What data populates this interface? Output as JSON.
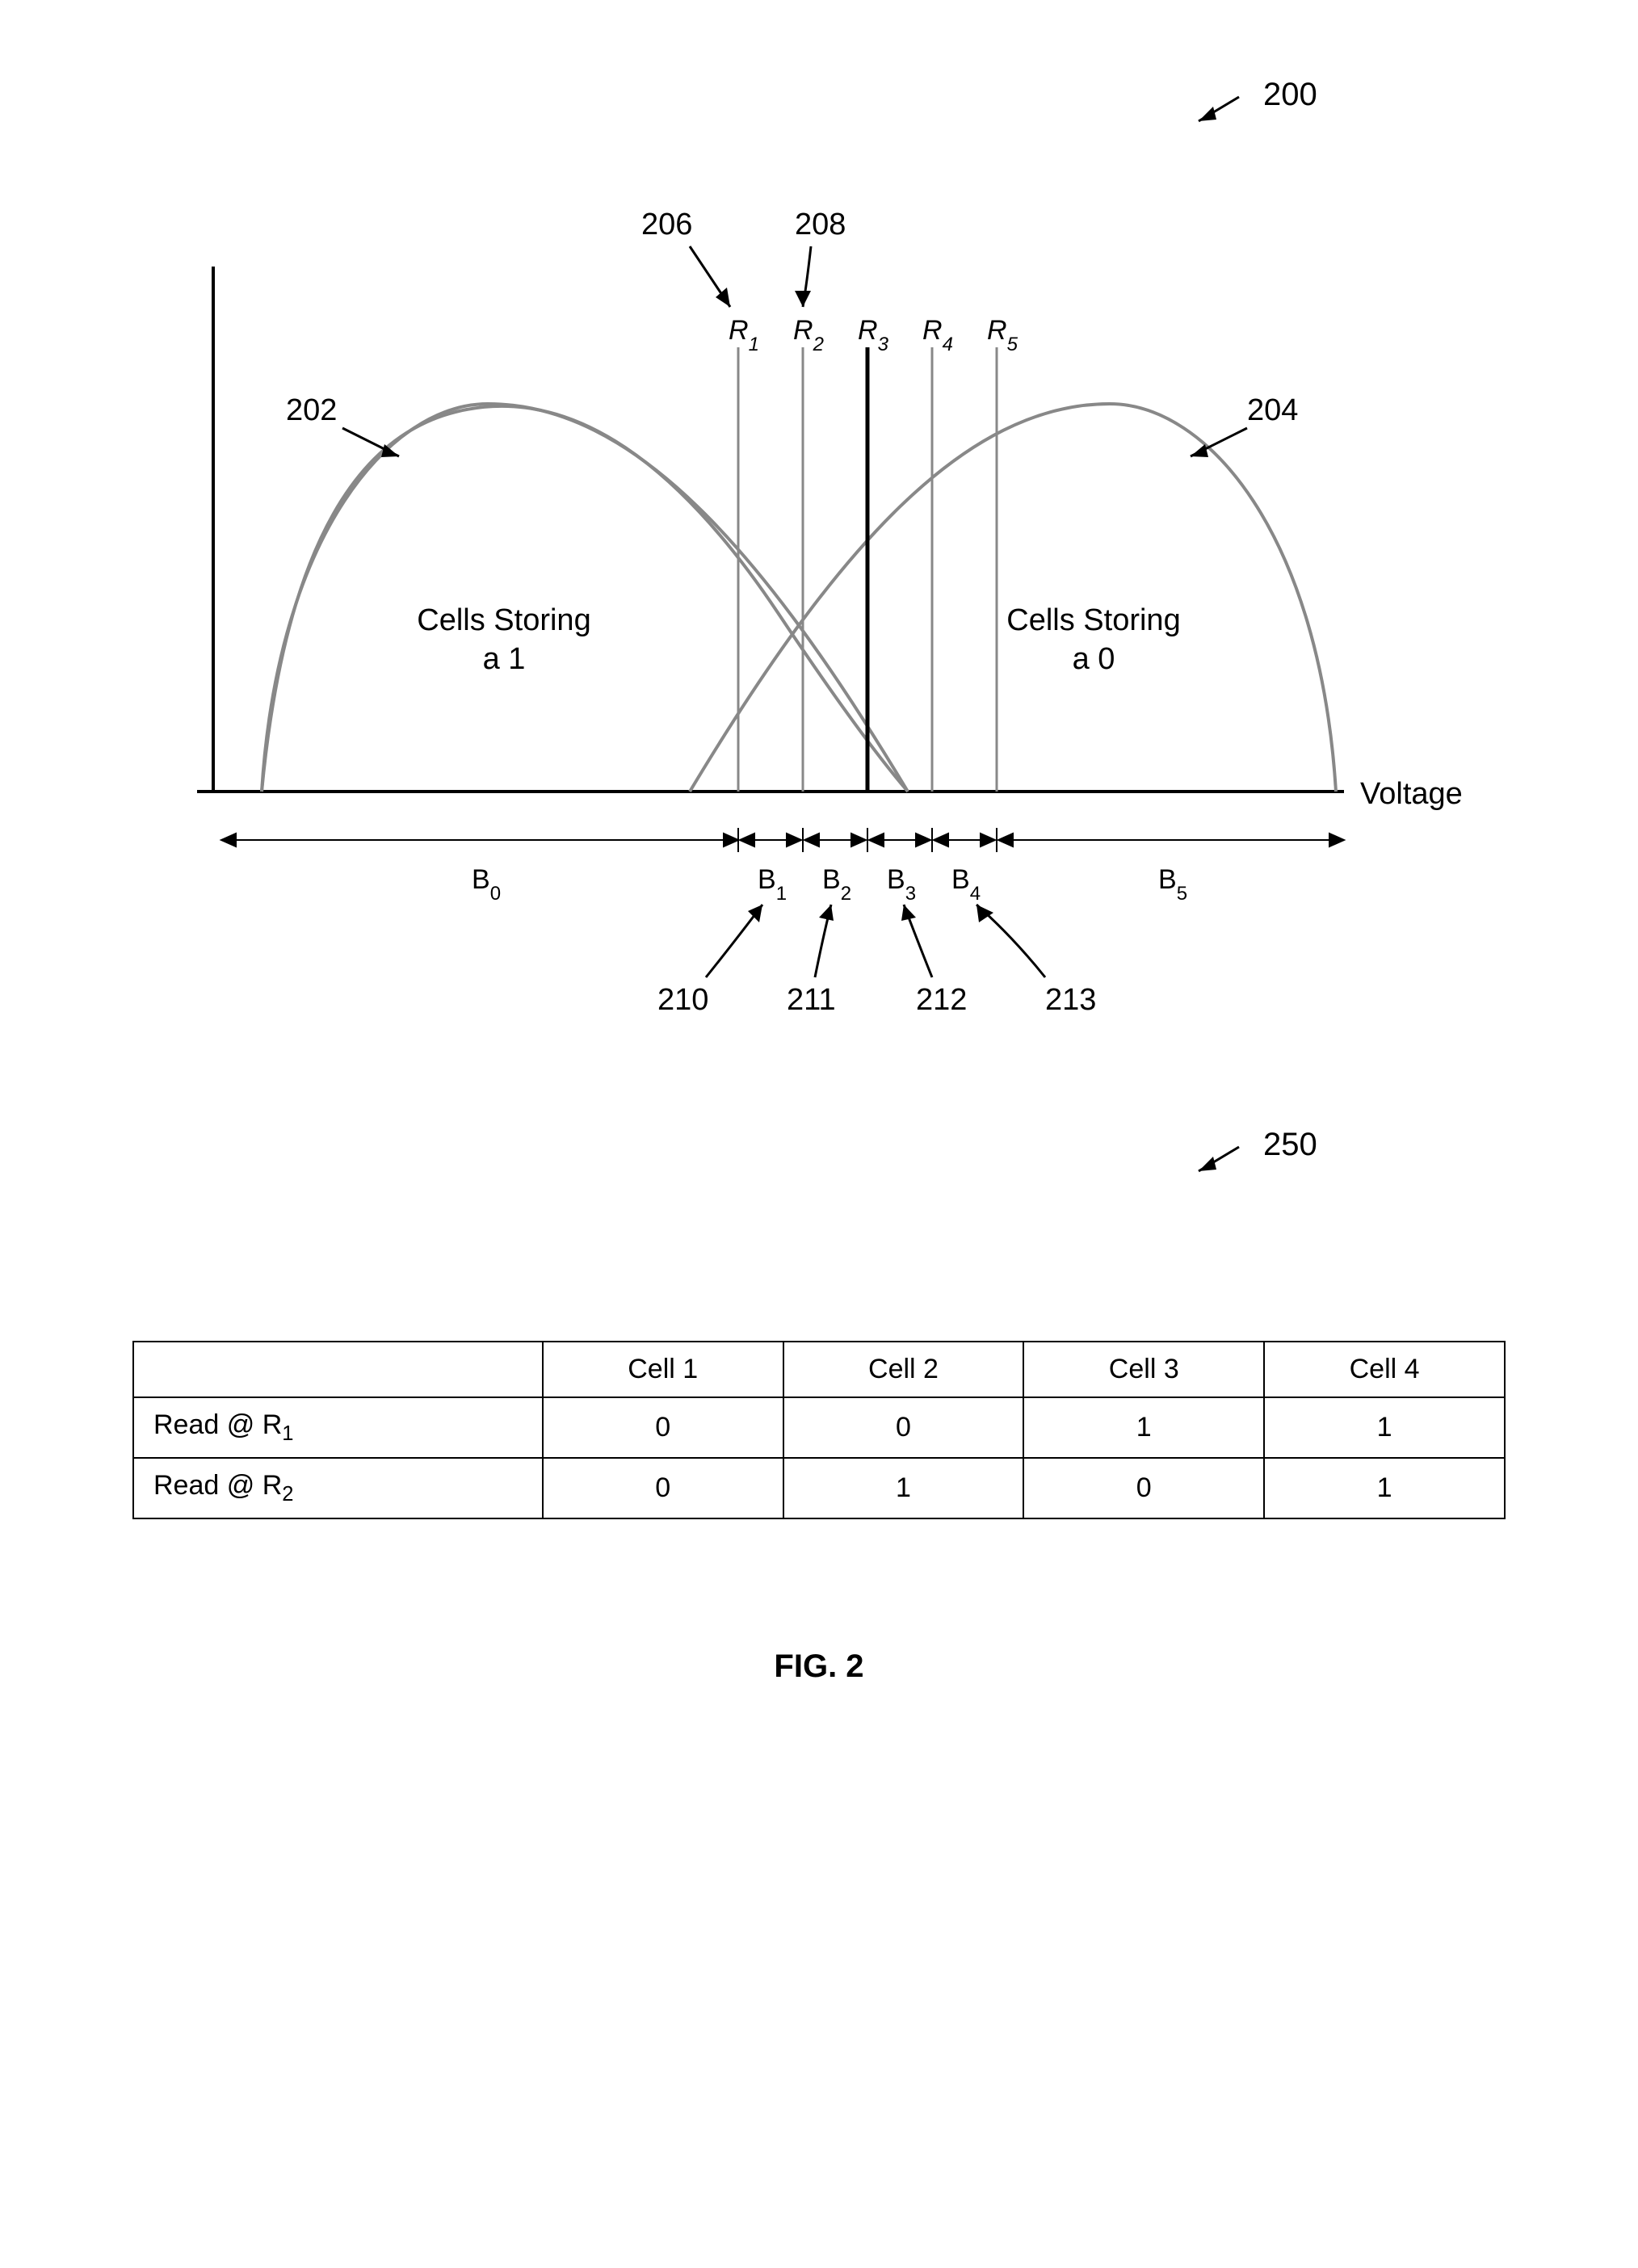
{
  "figure_ref_top": "200",
  "figure_ref_bottom": "250",
  "chart": {
    "y_axis_label": "",
    "x_axis_label": "Voltage",
    "curve_left_label": "Cells Storing\na 1",
    "curve_right_label": "Cells Storing\na 0",
    "curve_left_ref": "202",
    "curve_right_ref": "204",
    "reads": [
      "R",
      "R",
      "R",
      "R",
      "R"
    ],
    "read_subs": [
      "1",
      "2",
      "3",
      "4",
      "5"
    ],
    "bins": [
      "B",
      "B",
      "B",
      "B",
      "B",
      "B"
    ],
    "bin_subs": [
      "0",
      "1",
      "2",
      "3",
      "4",
      "5"
    ],
    "ref_206": "206",
    "ref_208": "208",
    "ref_210": "210",
    "ref_211": "211",
    "ref_212": "212",
    "ref_213": "213"
  },
  "table": {
    "header_blank": "",
    "headers": [
      "Cell 1",
      "Cell 2",
      "Cell 3",
      "Cell 4"
    ],
    "rows": [
      {
        "label_prefix": "Read @ R",
        "label_sub": "1",
        "cells": [
          "0",
          "0",
          "1",
          "1"
        ]
      },
      {
        "label_prefix": "Read @ R",
        "label_sub": "2",
        "cells": [
          "0",
          "1",
          "0",
          "1"
        ]
      }
    ]
  },
  "fig_caption": "FIG. 2"
}
